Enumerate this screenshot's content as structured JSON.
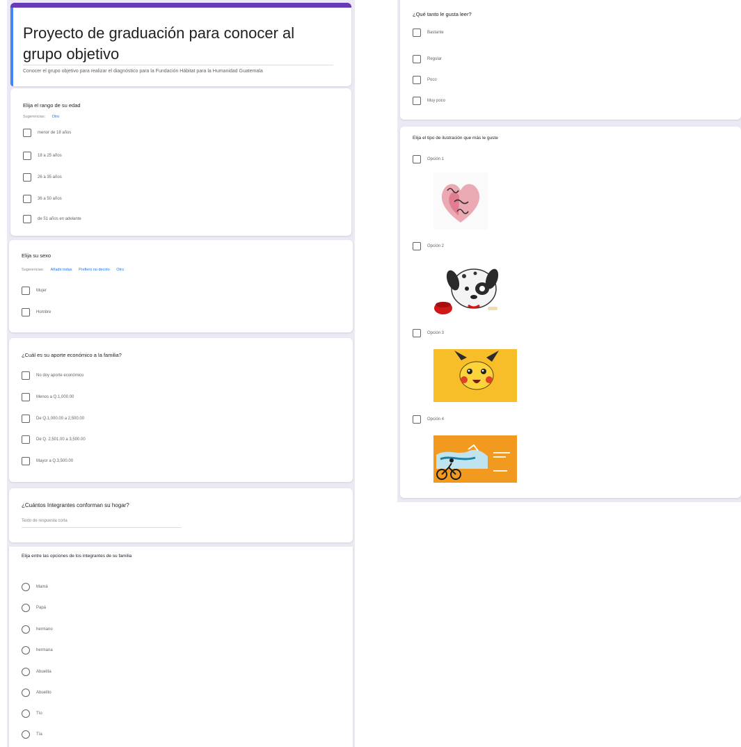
{
  "form": {
    "title": "Proyecto de graduación para conocer al grupo objetivo",
    "description": "Conocer el grupo objetivo para realizar el diagnóstico para la Fundación Hábitat para la Humanidad Guatemala",
    "accent_color": "#673ab7"
  },
  "q_age": {
    "title": "Elija el rango de su edad",
    "suggestions_label": "Sugerencias:",
    "suggestion_links": [
      "Otro"
    ],
    "options": [
      "menor de 18 años",
      "18 a 25 años",
      "26 a 35 años",
      "36 a 50 años",
      "de 51 años en adelante"
    ]
  },
  "q_sex": {
    "title": "Elija su sexo",
    "suggestions_label": "Sugerencias:",
    "suggestion_links": [
      "Añadir todas",
      "Prefiero no decirlo",
      "Otro"
    ],
    "options": [
      "Mujer",
      "Hombre"
    ]
  },
  "q_income": {
    "title": "¿Cuál es su aporte económico a la familia?",
    "options": [
      "No doy aporte económico",
      "Menos a Q.1,000.00",
      "De Q.1,000.00 a 2,500.00",
      "De Q. 2,501.00 a 3,500.00",
      "Mayor a Q.3,500.00"
    ]
  },
  "q_household": {
    "title": "¿Cuántos Integrantes conforman su hogar?",
    "placeholder": "Texto de respuesta corta"
  },
  "q_family": {
    "title": "Elija entre las opciones de los integrantes de su familia",
    "options": [
      "Mamá",
      "Papá",
      "hermano",
      "hermana",
      "Abuelita",
      "Abuelito",
      "Tío",
      "Tía"
    ]
  },
  "q_reading": {
    "title": "¿Qué tanto le gusta leer?",
    "options": [
      "Bastante",
      "Regular",
      "Poco",
      "Muy poco"
    ]
  },
  "q_illustration": {
    "title": "Elija el tipo de ilustración que más le guste",
    "options": [
      {
        "label": "Opción 1",
        "image": "watercolor-heart-lettering-image"
      },
      {
        "label": "Opción 2",
        "image": "dalmatian-puppy-image"
      },
      {
        "label": "Opción 3",
        "image": "pikachu-face-image"
      },
      {
        "label": "Opción 4",
        "image": "cyclist-orange-poster-image"
      }
    ]
  }
}
